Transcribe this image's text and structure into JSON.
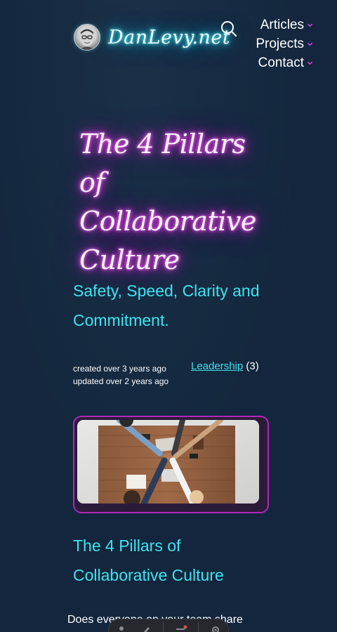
{
  "header": {
    "brand_name": "DanLevy.net",
    "nav": [
      {
        "label": "Articles"
      },
      {
        "label": "Projects"
      },
      {
        "label": "Contact"
      }
    ]
  },
  "article": {
    "title": "The 4 Pillars of Collaborative Culture",
    "subtitle": "Safety, Speed, Clarity and Commitment.",
    "created": "created over 3 years ago",
    "updated": "updated over 2 years ago",
    "tag": "Leadership",
    "tag_count": "(3)",
    "section_heading": "The 4 Pillars of Collaborative Culture",
    "body_start": "Does everyone on your team share"
  },
  "colors": {
    "background": "#13263d",
    "cyan_accent": "#3fe3f0",
    "magenta_accent": "#e83fe8",
    "frame_border": "#b128b8"
  },
  "icons": {
    "search": "search-icon",
    "chevron": "chevron-down-icon"
  }
}
